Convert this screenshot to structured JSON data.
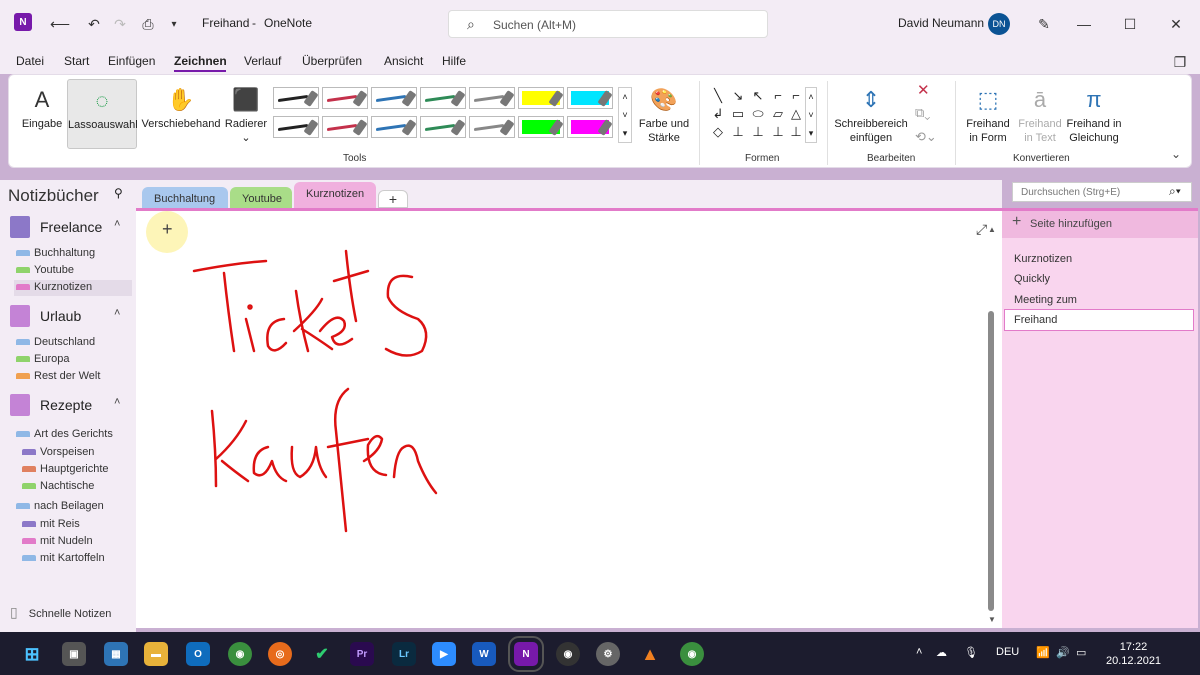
{
  "app": {
    "doc_title": "Freihand",
    "separator": "-",
    "app_name": "OneNote",
    "user_name": "David Neumann",
    "user_initials": "DN",
    "search_placeholder": "Suchen (Alt+M)"
  },
  "menu": [
    "Datei",
    "Start",
    "Einfügen",
    "Zeichnen",
    "Verlauf",
    "Überprüfen",
    "Ansicht",
    "Hilfe"
  ],
  "ribbon": {
    "eingabe": "Eingabe",
    "lasso": "Lassoauswahl",
    "verschiebehand": "Verschiebehand",
    "radierer": "Radierer",
    "farbe_line1": "Farbe und",
    "farbe_line2": "Stärke",
    "tools_label": "Tools",
    "formen_label": "Formen",
    "schreib_line1": "Schreibbereich",
    "schreib_line2": "einfügen",
    "bearbeiten_label": "Bearbeiten",
    "fif_line1": "Freihand",
    "fif_line2": "in Form",
    "fit_line1": "Freihand",
    "fit_line2": "in Text",
    "fig_line1": "Freihand in",
    "fig_line2": "Gleichung",
    "konvertieren_label": "Konvertieren",
    "pen_colors": [
      "#222222",
      "#c4314b",
      "#2e74b5",
      "#2e8b57",
      "#888888",
      "#ffff00",
      "#00e5ff",
      "#222222",
      "#c4314b",
      "#2e74b5",
      "#2e8b57",
      "#888888",
      "#00ff00",
      "#ff00ff"
    ]
  },
  "notebooks": {
    "title": "Notizbücher",
    "freelance": "Freelance",
    "freelance_sections": [
      "Buchhaltung",
      "Youtube",
      "Kurznotizen"
    ],
    "urlaub": "Urlaub",
    "urlaub_sections": [
      "Deutschland",
      "Europa",
      "Rest der Welt"
    ],
    "rezepte": "Rezepte",
    "group1": "Art des Gerichts",
    "group1_sections": [
      "Vorspeisen",
      "Hauptgerichte",
      "Nachtische"
    ],
    "group2": "nach Beilagen",
    "group2_sections": [
      "mit Reis",
      "mit Nudeln",
      "mit Kartoffeln"
    ],
    "quick_notes": "Schnelle Notizen"
  },
  "section_tabs": [
    "Buchhaltung",
    "Youtube",
    "Kurznotizen"
  ],
  "search_notebook_placeholder": "Durchsuchen (Strg+E)",
  "pages": {
    "add_page": "Seite hinzufügen",
    "items": [
      "Kurznotizen",
      "Quickly",
      "Meeting zum",
      "Freihand"
    ]
  },
  "taskbar": {
    "lang": "DEU",
    "time": "17:22",
    "date": "20.12.2021"
  }
}
